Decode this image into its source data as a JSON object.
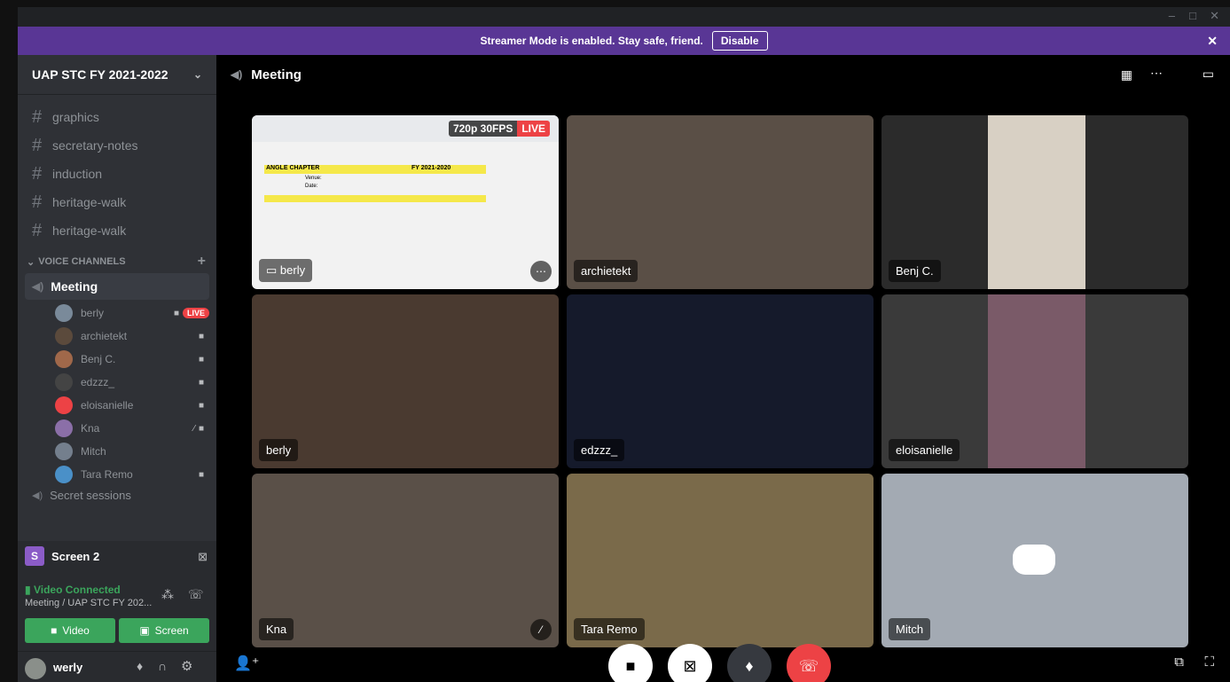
{
  "banner": {
    "message": "Streamer Mode is enabled. Stay safe, friend.",
    "disable_label": "Disable"
  },
  "server": {
    "name": "UAP STC FY 2021-2022"
  },
  "channels": [
    "graphics",
    "secretary-notes",
    "induction",
    "heritage-walk",
    "heritage-walk"
  ],
  "voice_category": "VOICE CHANNELS",
  "voice_channel": {
    "name": "Meeting"
  },
  "voice_users": [
    {
      "name": "berly",
      "live": "LIVE",
      "color": "#7a8a9a"
    },
    {
      "name": "archietekt",
      "color": "#5b4a3c"
    },
    {
      "name": "Benj C.",
      "color": "#a0684a"
    },
    {
      "name": "edzzz_",
      "color": "#444444"
    },
    {
      "name": "eloisanielle",
      "color": "#ed4245"
    },
    {
      "name": "Kna",
      "color": "#8b6fa8"
    },
    {
      "name": "Mitch",
      "color": "#747f8d"
    },
    {
      "name": "Tara Remo",
      "color": "#4a90c8"
    }
  ],
  "secret_channel": "Secret sessions",
  "stream": {
    "name": "Screen 2",
    "icon_letter": "S"
  },
  "voice_status": {
    "title": "Video Connected",
    "subtitle": "Meeting / UAP STC FY 202..."
  },
  "buttons": {
    "video": "Video",
    "screen": "Screen"
  },
  "user": {
    "name": "werly"
  },
  "main_header": {
    "channel": "Meeting"
  },
  "stream_badge": {
    "quality": "720p 30FPS",
    "live": "LIVE"
  },
  "spreadsheet": {
    "title": "ANGLE CHAPTER",
    "year": "FY 2021-2020",
    "venue": "Venue:",
    "date": "Date:"
  },
  "tiles": [
    {
      "name": "berly",
      "color": "#f2f2f2"
    },
    {
      "name": "archietekt",
      "color": "#5a4f46"
    },
    {
      "name": "Benj C.",
      "color": "#2b2b2b"
    },
    {
      "name": "berly",
      "color": "#4a3a30"
    },
    {
      "name": "edzzz_",
      "color": "#151a2b"
    },
    {
      "name": "eloisanielle",
      "color": "#3a3a3a"
    },
    {
      "name": "Kna",
      "color": "#5a5048"
    },
    {
      "name": "Tara Remo",
      "color": "#7a6a4a"
    },
    {
      "name": "Mitch",
      "color": "#a3aab3"
    }
  ],
  "colors": {
    "accent": "#5865f2",
    "streamer": "#593695",
    "connected": "#3ba55c",
    "live": "#ed4245",
    "hangup": "#ed4245"
  },
  "icons": {
    "camera": "camera-icon",
    "screen": "screen-share-icon",
    "mic": "microphone-icon",
    "hangup": "hang-up-icon"
  }
}
